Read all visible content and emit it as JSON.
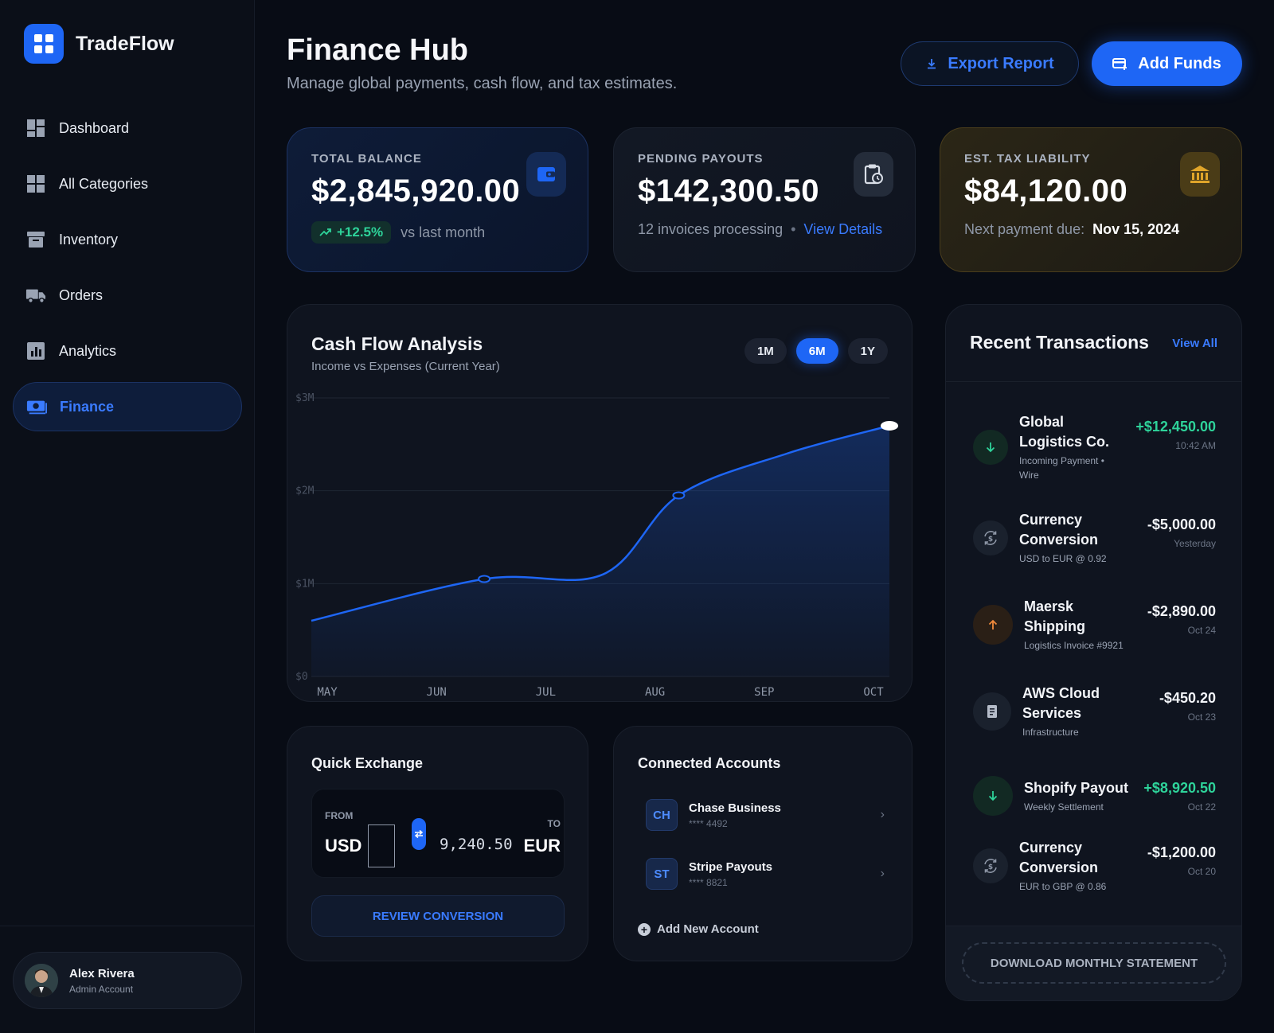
{
  "app": {
    "name": "TradeFlow"
  },
  "sidebar": {
    "items": [
      {
        "label": "Dashboard",
        "icon": "dashboard-grid-icon"
      },
      {
        "label": "All Categories",
        "icon": "categories-grid-icon"
      },
      {
        "label": "Inventory",
        "icon": "archive-box-icon"
      },
      {
        "label": "Orders",
        "icon": "truck-icon"
      },
      {
        "label": "Analytics",
        "icon": "bar-chart-icon"
      },
      {
        "label": "Finance",
        "icon": "money-icon",
        "active": true
      }
    ],
    "user": {
      "name": "Alex Rivera",
      "role": "Admin Account"
    }
  },
  "header": {
    "title": "Finance Hub",
    "subtitle": "Manage global payments, cash flow, and tax estimates.",
    "export_label": "Export Report",
    "add_funds_label": "Add Funds"
  },
  "stats": {
    "balance": {
      "label": "TOTAL BALANCE",
      "value": "$2,845,920.00",
      "change": "+12.5%",
      "change_note": "vs last month"
    },
    "payouts": {
      "label": "PENDING PAYOUTS",
      "value": "$142,300.50",
      "note": "12 invoices processing",
      "link": "View Details"
    },
    "tax": {
      "label": "EST. TAX LIABILITY",
      "value": "$84,120.00",
      "note": "Next payment due:",
      "due": "Nov 15, 2024"
    }
  },
  "cashflow": {
    "title": "Cash Flow Analysis",
    "subtitle": "Income vs Expenses (Current Year)",
    "ranges": [
      "1M",
      "6M",
      "1Y"
    ],
    "active_range": "6M"
  },
  "chart_data": {
    "type": "area",
    "title": "Cash Flow Analysis",
    "subtitle": "Income vs Expenses (Current Year)",
    "categories": [
      "MAY",
      "JUN",
      "JUL",
      "AUG",
      "SEP",
      "OCT"
    ],
    "x": [
      0,
      1.6,
      2.7,
      3.4,
      4.4,
      5.35
    ],
    "y": [
      0.6,
      1.05,
      1.1,
      1.95,
      2.4,
      2.7
    ],
    "markers": [
      1.6,
      3.4,
      5.35
    ],
    "yticks": [
      "$0",
      "$1M",
      "$2M",
      "$3M"
    ],
    "ylim": [
      0,
      3
    ],
    "grid": true,
    "accent": "#1e66f5"
  },
  "exchange": {
    "title": "Quick Exchange",
    "from_label": "FROM",
    "to_label": "TO",
    "from_currency": "USD",
    "to_currency": "EUR",
    "amount": "9,240.50",
    "button": "REVIEW CONVERSION"
  },
  "accounts": {
    "title": "Connected Accounts",
    "items": [
      {
        "badge": "CH",
        "name": "Chase Business",
        "number": "**** 4492"
      },
      {
        "badge": "ST",
        "name": "Stripe Payouts",
        "number": "**** 8821"
      }
    ],
    "add_label": "Add New Account"
  },
  "transactions": {
    "title": "Recent Transactions",
    "view_all": "View All",
    "items": [
      {
        "name": "Global Logistics Co.",
        "meta": "Incoming Payment • Wire",
        "amount": "+$12,450.00",
        "time": "10:42 AM",
        "type": "in"
      },
      {
        "name": "Currency Conversion",
        "meta": "USD to EUR @ 0.92",
        "amount": "-$5,000.00",
        "time": "Yesterday",
        "type": "conv"
      },
      {
        "name": "Maersk Shipping",
        "meta": "Logistics Invoice #9921",
        "amount": "-$2,890.00",
        "time": "Oct 24",
        "type": "out"
      },
      {
        "name": "AWS Cloud Services",
        "meta": "Infrastructure",
        "amount": "-$450.20",
        "time": "Oct 23",
        "type": "doc"
      },
      {
        "name": "Shopify Payout",
        "meta": "Weekly Settlement",
        "amount": "+$8,920.50",
        "time": "Oct 22",
        "type": "in"
      },
      {
        "name": "Currency Conversion",
        "meta": "EUR to GBP @ 0.86",
        "amount": "-$1,200.00",
        "time": "Oct 20",
        "type": "conv"
      }
    ],
    "download_label": "DOWNLOAD MONTHLY STATEMENT"
  }
}
